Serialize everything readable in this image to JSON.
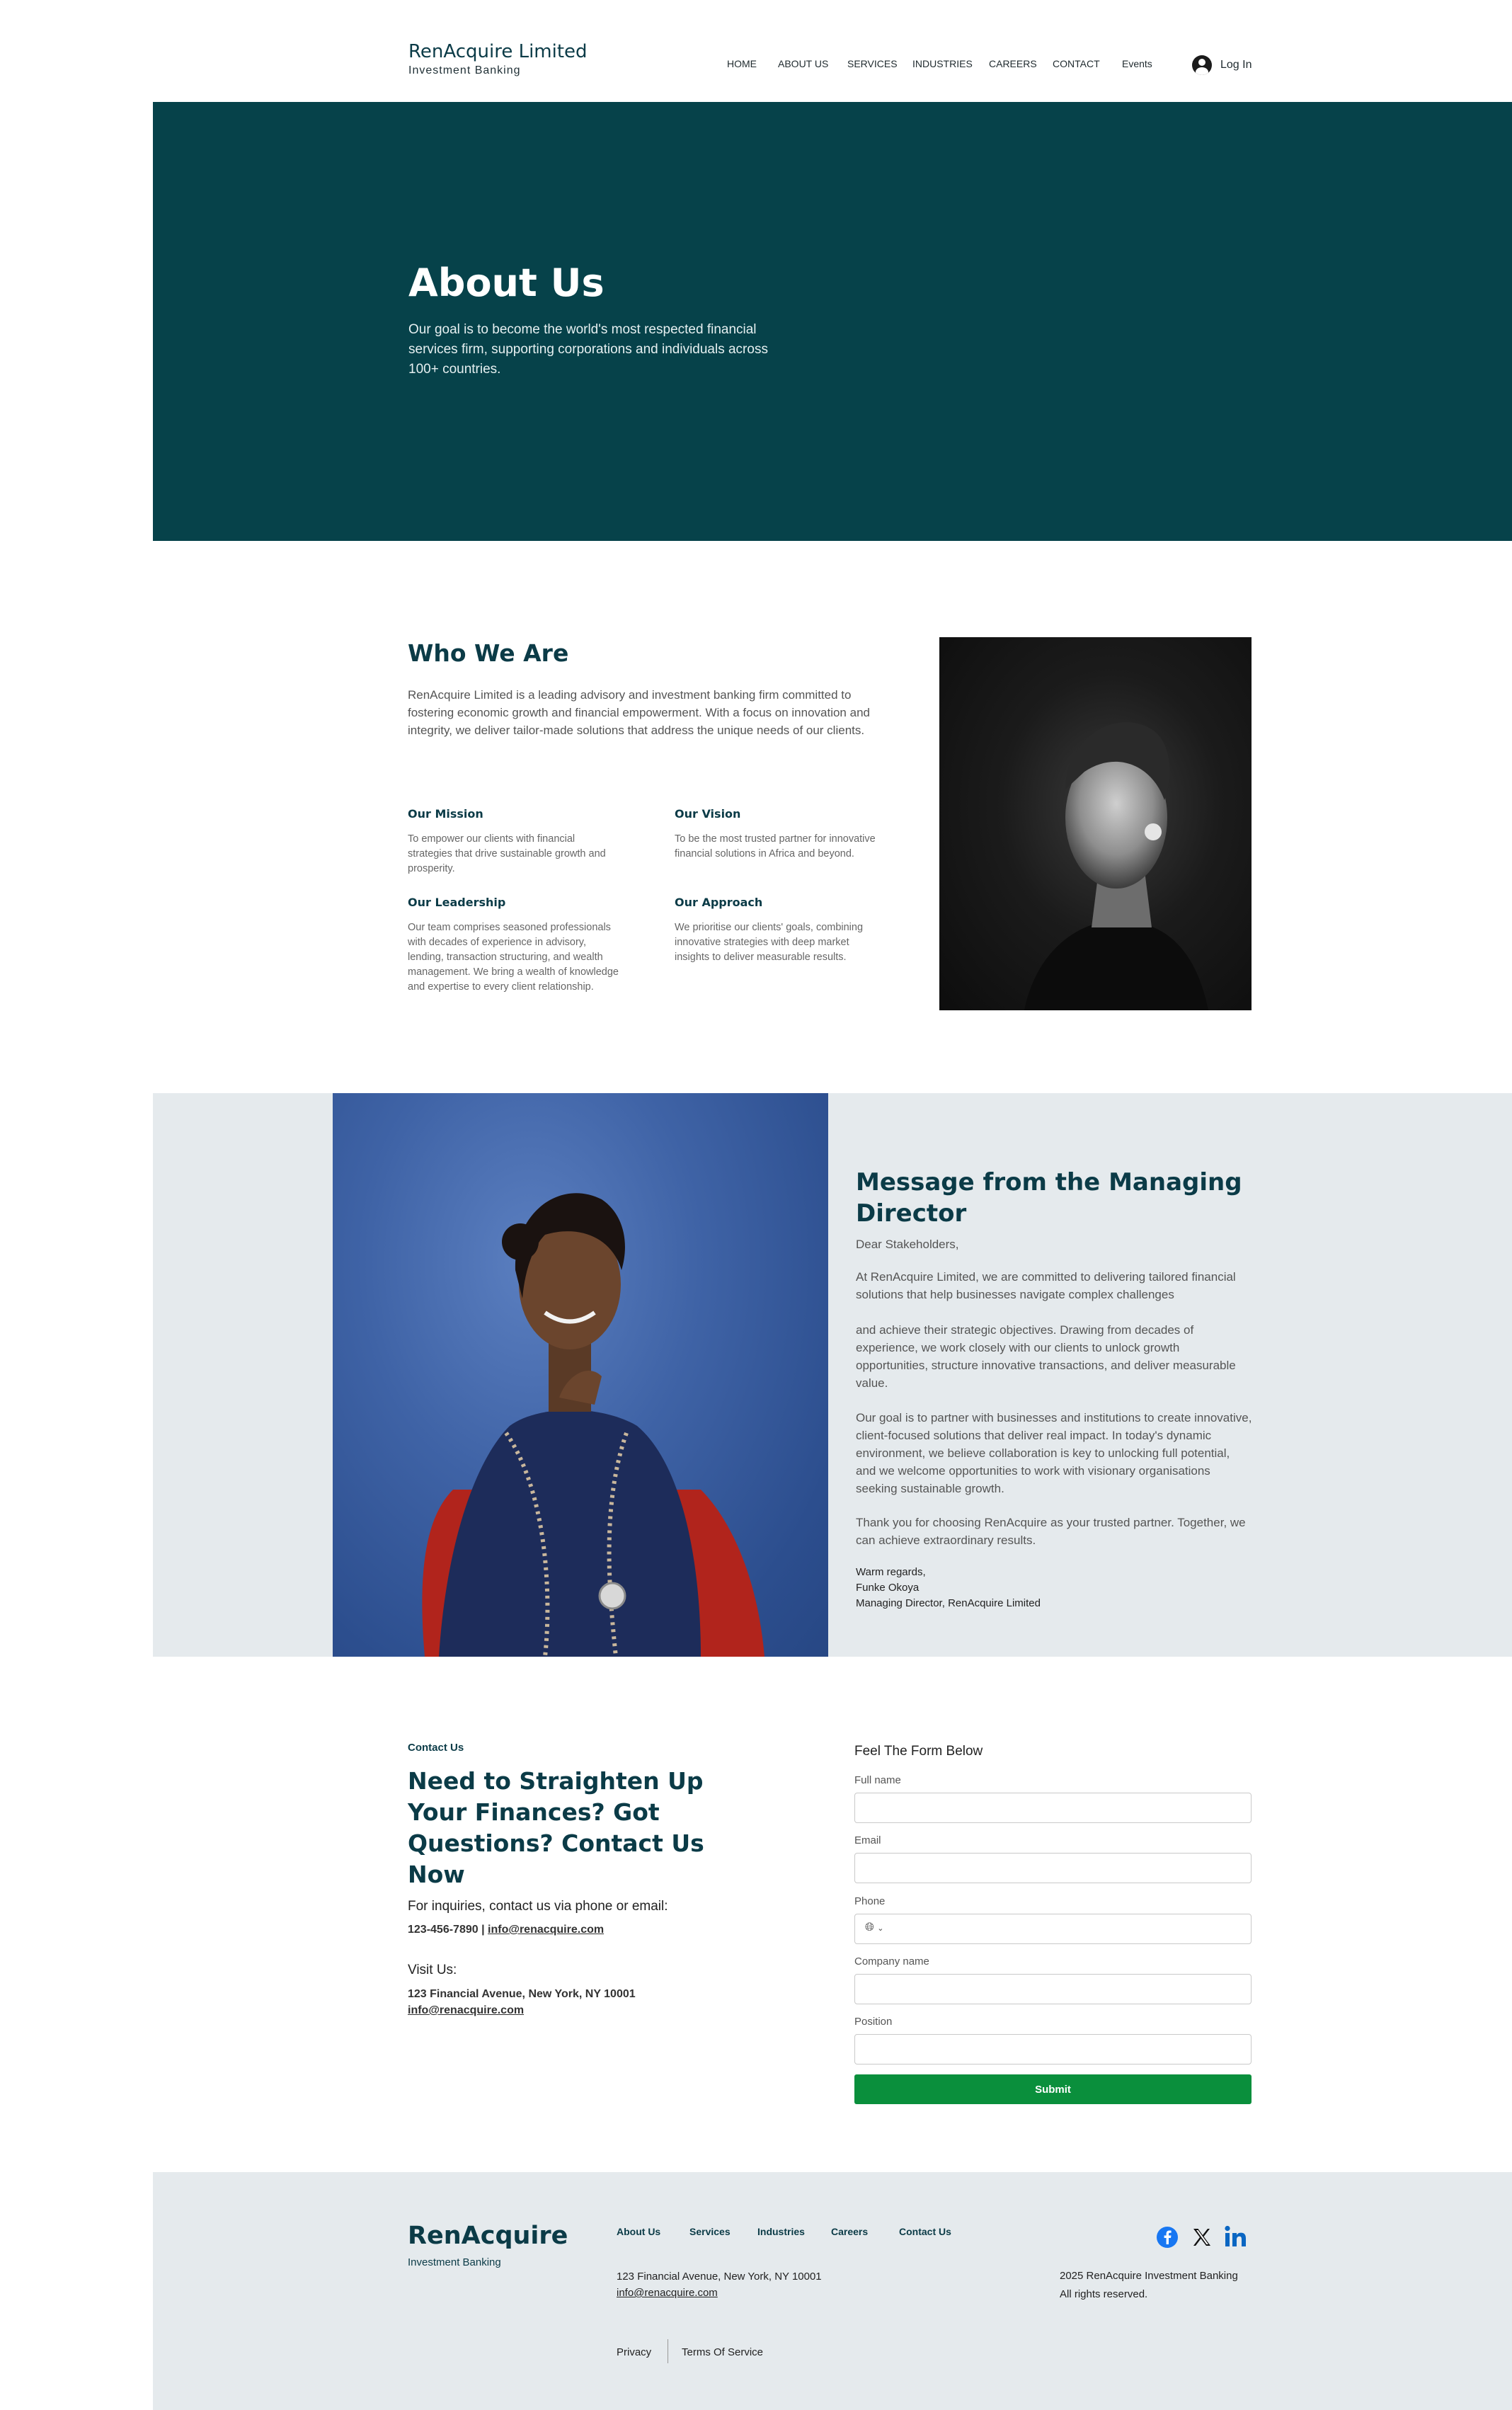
{
  "header": {
    "brand_name": "RenAcquire Limited",
    "brand_sub": "Investment Banking",
    "nav": [
      "HOME",
      "ABOUT US",
      "SERVICES",
      "INDUSTRIES",
      "CAREERS",
      "CONTACT",
      "Events"
    ],
    "login_label": "Log In"
  },
  "hero": {
    "title": "About Us",
    "text": "Our goal is to become the world's most respected financial services firm, supporting corporations and individuals across 100+ countries."
  },
  "who": {
    "title": "Who We Are",
    "text": "RenAcquire Limited is a leading advisory and investment banking firm committed to fostering economic growth and financial empowerment. With a focus on innovation and integrity, we deliver tailor-made solutions that address the unique needs of our clients.",
    "mission": {
      "title": "Our Mission",
      "text": "To empower our clients with financial strategies that drive sustainable growth and prosperity."
    },
    "vision": {
      "title": "Our Vision",
      "text": "To be the most trusted partner for innovative financial solutions in Africa and beyond."
    },
    "leadership": {
      "title": "Our Leadership",
      "text": "Our team comprises seasoned professionals with decades of experience in advisory, lending, transaction structuring, and wealth management. We bring a wealth of knowledge and expertise to every client relationship."
    },
    "approach": {
      "title": "Our Approach",
      "text": "We prioritise our clients' goals, combining innovative strategies with deep market insights to deliver measurable results."
    }
  },
  "message": {
    "title": "Message from the Managing Director",
    "greeting": "Dear Stakeholders,",
    "p1": "At RenAcquire Limited, we are committed to delivering tailored financial solutions that help businesses navigate complex challenges",
    "p1b": "and achieve their strategic objectives. Drawing from decades of experience, we work closely with our clients to unlock growth opportunities, structure innovative transactions, and deliver measurable value.",
    "p2": "Our goal is to partner with businesses and institutions to create innovative, client-focused solutions that deliver real impact. In today's dynamic environment, we believe collaboration is key to unlocking full potential, and we welcome opportunities to work with visionary organisations seeking sustainable growth.",
    "p3": "Thank you for choosing RenAcquire as your trusted partner. Together, we can achieve extraordinary results.",
    "sign1": "Warm regards,",
    "sign2": "Funke Okoya",
    "sign3": "Managing Director, RenAcquire Limited"
  },
  "contact": {
    "kicker": "Contact Us",
    "title": "Need to Straighten Up Your Finances? Got Questions? Contact Us Now",
    "inquiries": "For inquiries, contact us via phone or email:",
    "phone": "123-456-7890",
    "sep": " | ",
    "email": "info@renacquire.com",
    "visit": "Visit Us:",
    "address": "123 Financial Avenue, New York, NY 10001",
    "visit_email": "info@renacquire.com"
  },
  "form": {
    "title": "Feel The Form Below",
    "full_name": "Full name",
    "email": "Email",
    "phone": "Phone",
    "company": "Company name",
    "position": "Position",
    "submit": "Submit"
  },
  "footer": {
    "brand": "RenAcquire",
    "brand_sub": "Investment Banking",
    "links": [
      "About Us",
      "Services",
      "Industries",
      "Careers",
      "Contact Us"
    ],
    "address": "123 Financial Avenue, New York, NY 10001",
    "email": "info@renacquire.com",
    "privacy": "Privacy",
    "terms": "Terms Of Service",
    "copyright1": "2025 RenAcquire Investment Banking",
    "copyright2": "All rights reserved.",
    "social": [
      "facebook-icon",
      "x-icon",
      "linkedin-icon"
    ],
    "colors": {
      "facebook": "#1877f2",
      "x": "#111111",
      "linkedin": "#0a66c2"
    }
  }
}
